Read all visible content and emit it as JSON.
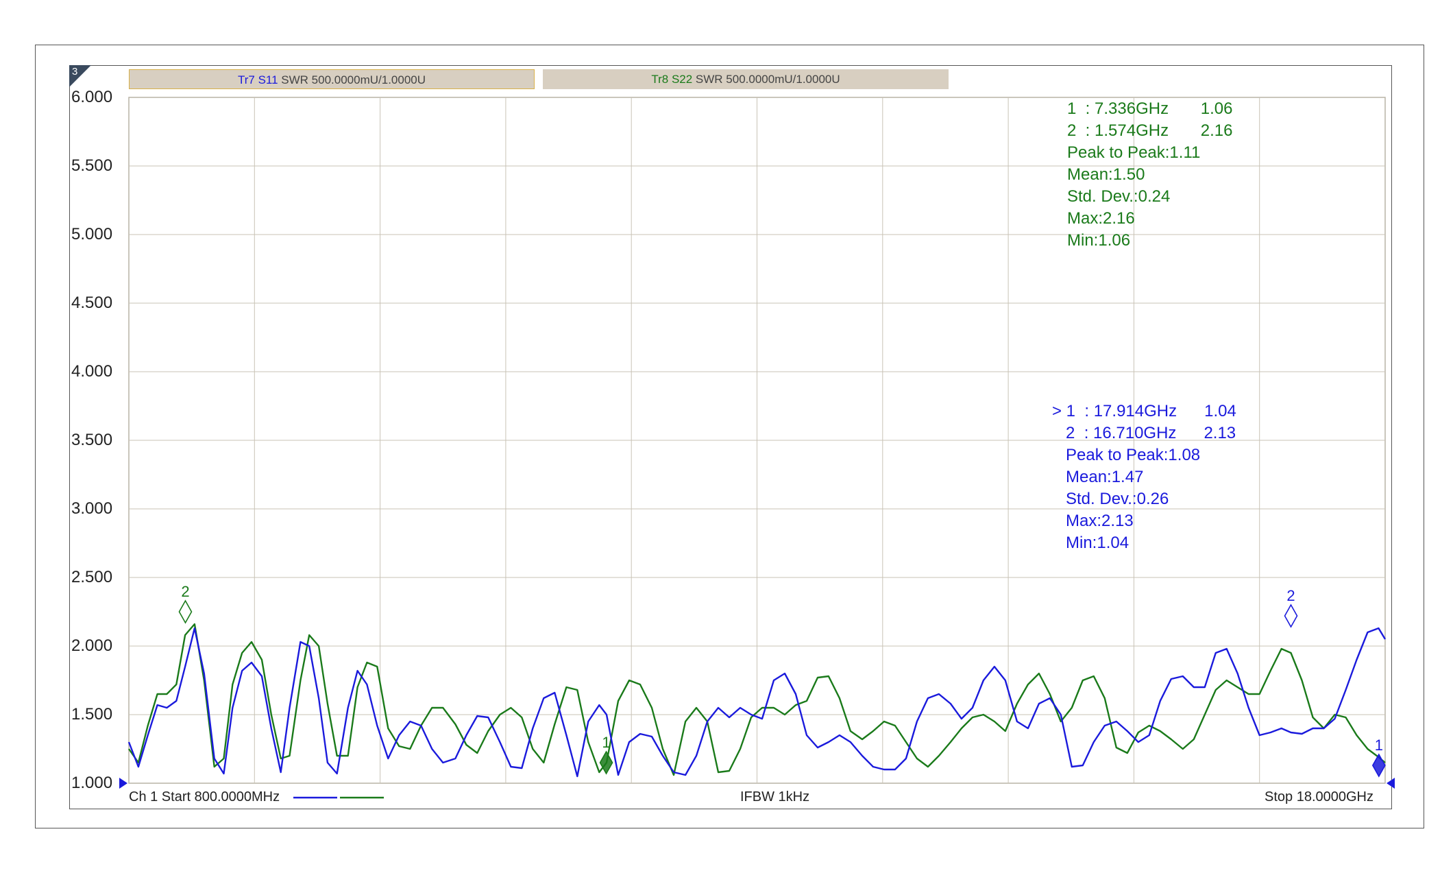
{
  "channel_number": "3",
  "traces": [
    {
      "name": "Tr7",
      "param": "S11",
      "format": "SWR 500.0000mU/1.0000U",
      "color": "#1a1adc"
    },
    {
      "name": "Tr8",
      "param": "S22",
      "format": "SWR 500.0000mU/1.0000U",
      "color": "#1a7a1a"
    }
  ],
  "footer": {
    "start": "Ch 1 Start 800.0000MHz",
    "ifbw": "IFBW 1kHz",
    "stop": "Stop 18.0000GHz"
  },
  "stats_green": [
    "1  : 7.336GHz       1.06",
    "2  : 1.574GHz       2.16",
    "Peak to Peak:1.11",
    "Mean:1.50",
    "Std. Dev.:0.24",
    "Max:2.16",
    "Min:1.06"
  ],
  "stats_blue": [
    "> 1  : 17.914GHz      1.04",
    "   2  : 16.710GHz      2.13",
    "   Peak to Peak:1.08",
    "   Mean:1.47",
    "   Std. Dev.:0.26",
    "   Max:2.13",
    "   Min:1.04"
  ],
  "chart_data": {
    "type": "line",
    "ylim": [
      1.0,
      6.0
    ],
    "xlim_ghz": [
      0.8,
      18.0
    ],
    "y_ticks": [
      "6.000",
      "5.500",
      "5.000",
      "4.500",
      "4.000",
      "3.500",
      "3.000",
      "2.500",
      "2.000",
      "1.500",
      "1.000"
    ],
    "grid": true,
    "x_ghz": [
      0.8,
      0.93,
      1.06,
      1.19,
      1.32,
      1.45,
      1.57,
      1.7,
      1.83,
      1.97,
      2.1,
      2.22,
      2.35,
      2.48,
      2.62,
      2.75,
      2.88,
      3.0,
      3.15,
      3.27,
      3.4,
      3.52,
      3.65,
      3.8,
      3.93,
      4.06,
      4.2,
      4.35,
      4.5,
      4.65,
      4.8,
      4.95,
      5.1,
      5.27,
      5.42,
      5.57,
      5.72,
      5.88,
      6.03,
      6.18,
      6.33,
      6.48,
      6.63,
      6.79,
      6.94,
      7.09,
      7.24,
      7.34,
      7.5,
      7.65,
      7.8,
      7.96,
      8.11,
      8.26,
      8.42,
      8.57,
      8.72,
      8.87,
      9.02,
      9.17,
      9.32,
      9.47,
      9.63,
      9.78,
      9.93,
      10.08,
      10.23,
      10.38,
      10.53,
      10.68,
      10.84,
      10.99,
      11.14,
      11.29,
      11.44,
      11.59,
      11.74,
      11.89,
      12.05,
      12.2,
      12.35,
      12.5,
      12.65,
      12.8,
      12.96,
      13.11,
      13.26,
      13.41,
      13.56,
      13.71,
      13.86,
      14.01,
      14.16,
      14.32,
      14.47,
      14.62,
      14.77,
      14.92,
      15.07,
      15.23,
      15.38,
      15.53,
      15.68,
      15.83,
      15.98,
      16.13,
      16.28,
      16.43,
      16.58,
      16.71,
      16.86,
      17.01,
      17.16,
      17.31,
      17.46,
      17.61,
      17.76,
      17.91,
      18.0
    ],
    "series": [
      {
        "values": [
          1.3,
          1.12,
          1.35,
          1.57,
          1.55,
          1.6,
          1.85,
          2.13,
          1.8,
          1.18,
          1.07,
          1.55,
          1.82,
          1.88,
          1.78,
          1.4,
          1.08,
          1.55,
          2.03,
          2.0,
          1.62,
          1.15,
          1.07,
          1.55,
          1.82,
          1.72,
          1.42,
          1.18,
          1.35,
          1.45,
          1.42,
          1.25,
          1.15,
          1.18,
          1.35,
          1.49,
          1.48,
          1.3,
          1.12,
          1.11,
          1.4,
          1.62,
          1.66,
          1.35,
          1.05,
          1.45,
          1.57,
          1.5,
          1.06,
          1.3,
          1.36,
          1.34,
          1.2,
          1.08,
          1.06,
          1.2,
          1.45,
          1.55,
          1.48,
          1.55,
          1.5,
          1.47,
          1.75,
          1.8,
          1.65,
          1.35,
          1.26,
          1.3,
          1.35,
          1.3,
          1.2,
          1.12,
          1.1,
          1.1,
          1.18,
          1.45,
          1.62,
          1.65,
          1.58,
          1.47,
          1.55,
          1.75,
          1.85,
          1.75,
          1.45,
          1.4,
          1.58,
          1.62,
          1.5,
          1.12,
          1.13,
          1.3,
          1.42,
          1.45,
          1.38,
          1.3,
          1.35,
          1.6,
          1.76,
          1.78,
          1.7,
          1.7,
          1.95,
          1.98,
          1.8,
          1.55,
          1.35,
          1.37,
          1.4,
          1.37,
          1.36,
          1.4,
          1.4,
          1.47,
          1.68,
          1.9,
          2.1,
          2.13,
          2.05,
          1.85,
          1.9,
          1.88,
          1.72,
          1.5,
          1.25,
          1.1,
          1.08,
          1.04,
          1.1
        ]
      },
      {
        "values": [
          1.25,
          1.15,
          1.42,
          1.65,
          1.65,
          1.72,
          2.08,
          2.16,
          1.75,
          1.12,
          1.18,
          1.72,
          1.95,
          2.03,
          1.9,
          1.5,
          1.18,
          1.2,
          1.75,
          2.08,
          2.0,
          1.58,
          1.2,
          1.2,
          1.7,
          1.88,
          1.85,
          1.4,
          1.27,
          1.25,
          1.42,
          1.55,
          1.55,
          1.43,
          1.28,
          1.22,
          1.38,
          1.5,
          1.55,
          1.48,
          1.25,
          1.15,
          1.43,
          1.7,
          1.68,
          1.3,
          1.08,
          1.15,
          1.6,
          1.75,
          1.72,
          1.55,
          1.25,
          1.06,
          1.45,
          1.55,
          1.45,
          1.08,
          1.09,
          1.25,
          1.48,
          1.55,
          1.55,
          1.5,
          1.57,
          1.6,
          1.77,
          1.78,
          1.62,
          1.38,
          1.32,
          1.38,
          1.45,
          1.42,
          1.3,
          1.18,
          1.12,
          1.2,
          1.3,
          1.4,
          1.48,
          1.5,
          1.45,
          1.38,
          1.58,
          1.72,
          1.8,
          1.65,
          1.45,
          1.55,
          1.75,
          1.78,
          1.62,
          1.26,
          1.22,
          1.37,
          1.42,
          1.38,
          1.32,
          1.25,
          1.32,
          1.5,
          1.68,
          1.75,
          1.7,
          1.65,
          1.65,
          1.82,
          1.98,
          1.95,
          1.75,
          1.48,
          1.4,
          1.5,
          1.48,
          1.35,
          1.25,
          1.19,
          1.15,
          1.13,
          1.28,
          1.55,
          1.68,
          1.62,
          1.57,
          1.58,
          1.68,
          1.72,
          1.62,
          1.42,
          1.4,
          1.38,
          1.35,
          1.25
        ]
      }
    ],
    "markers_green": [
      {
        "label": "2",
        "x_ghz": 1.574,
        "y": 2.16
      },
      {
        "label": "1",
        "x_ghz": 7.336,
        "y": 1.06
      }
    ],
    "markers_blue": [
      {
        "label": "2",
        "x_ghz": 16.71,
        "y": 2.13
      },
      {
        "label": "1",
        "x_ghz": 17.914,
        "y": 1.04
      }
    ]
  }
}
